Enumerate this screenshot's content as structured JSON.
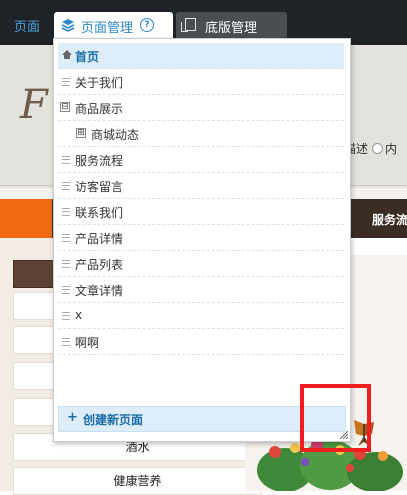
{
  "toolbar": {
    "first_tab": "页面",
    "tabs": [
      {
        "label": "页面管理",
        "icon": "layers-icon",
        "help_icon": "?"
      },
      {
        "label": "底版管理",
        "icon": "document-copy-icon"
      }
    ]
  },
  "page_menu": {
    "items": [
      {
        "label": "首页",
        "icon": "home-icon",
        "active": true
      },
      {
        "label": "关于我们"
      },
      {
        "label": "商品展示",
        "expand_toggle": "⊟"
      },
      {
        "label": "商城动态",
        "expand_toggle": "⊞",
        "child": true
      },
      {
        "label": "服务流程"
      },
      {
        "label": "访客留言"
      },
      {
        "label": "联系我们"
      },
      {
        "label": "产品详情"
      },
      {
        "label": "产品列表"
      },
      {
        "label": "文章详情"
      },
      {
        "label": "x"
      },
      {
        "label": "啊啊"
      }
    ],
    "create_button": {
      "icon": "+",
      "label": "创建新页面"
    }
  },
  "website_preview": {
    "search_options": {
      "option_a": "描述",
      "option_b": "内"
    },
    "nav_item": "服务流",
    "side_menu": [
      "酒水",
      "健康营养"
    ]
  },
  "colors": {
    "toolbar_bg": "#1f2226",
    "accent_blue": "#2a86c7",
    "active_row_bg": "#ddeefa",
    "highlight_red": "#f01e1e",
    "nav_orange": "#ef6a12",
    "nav_brown": "#3b2d24"
  }
}
